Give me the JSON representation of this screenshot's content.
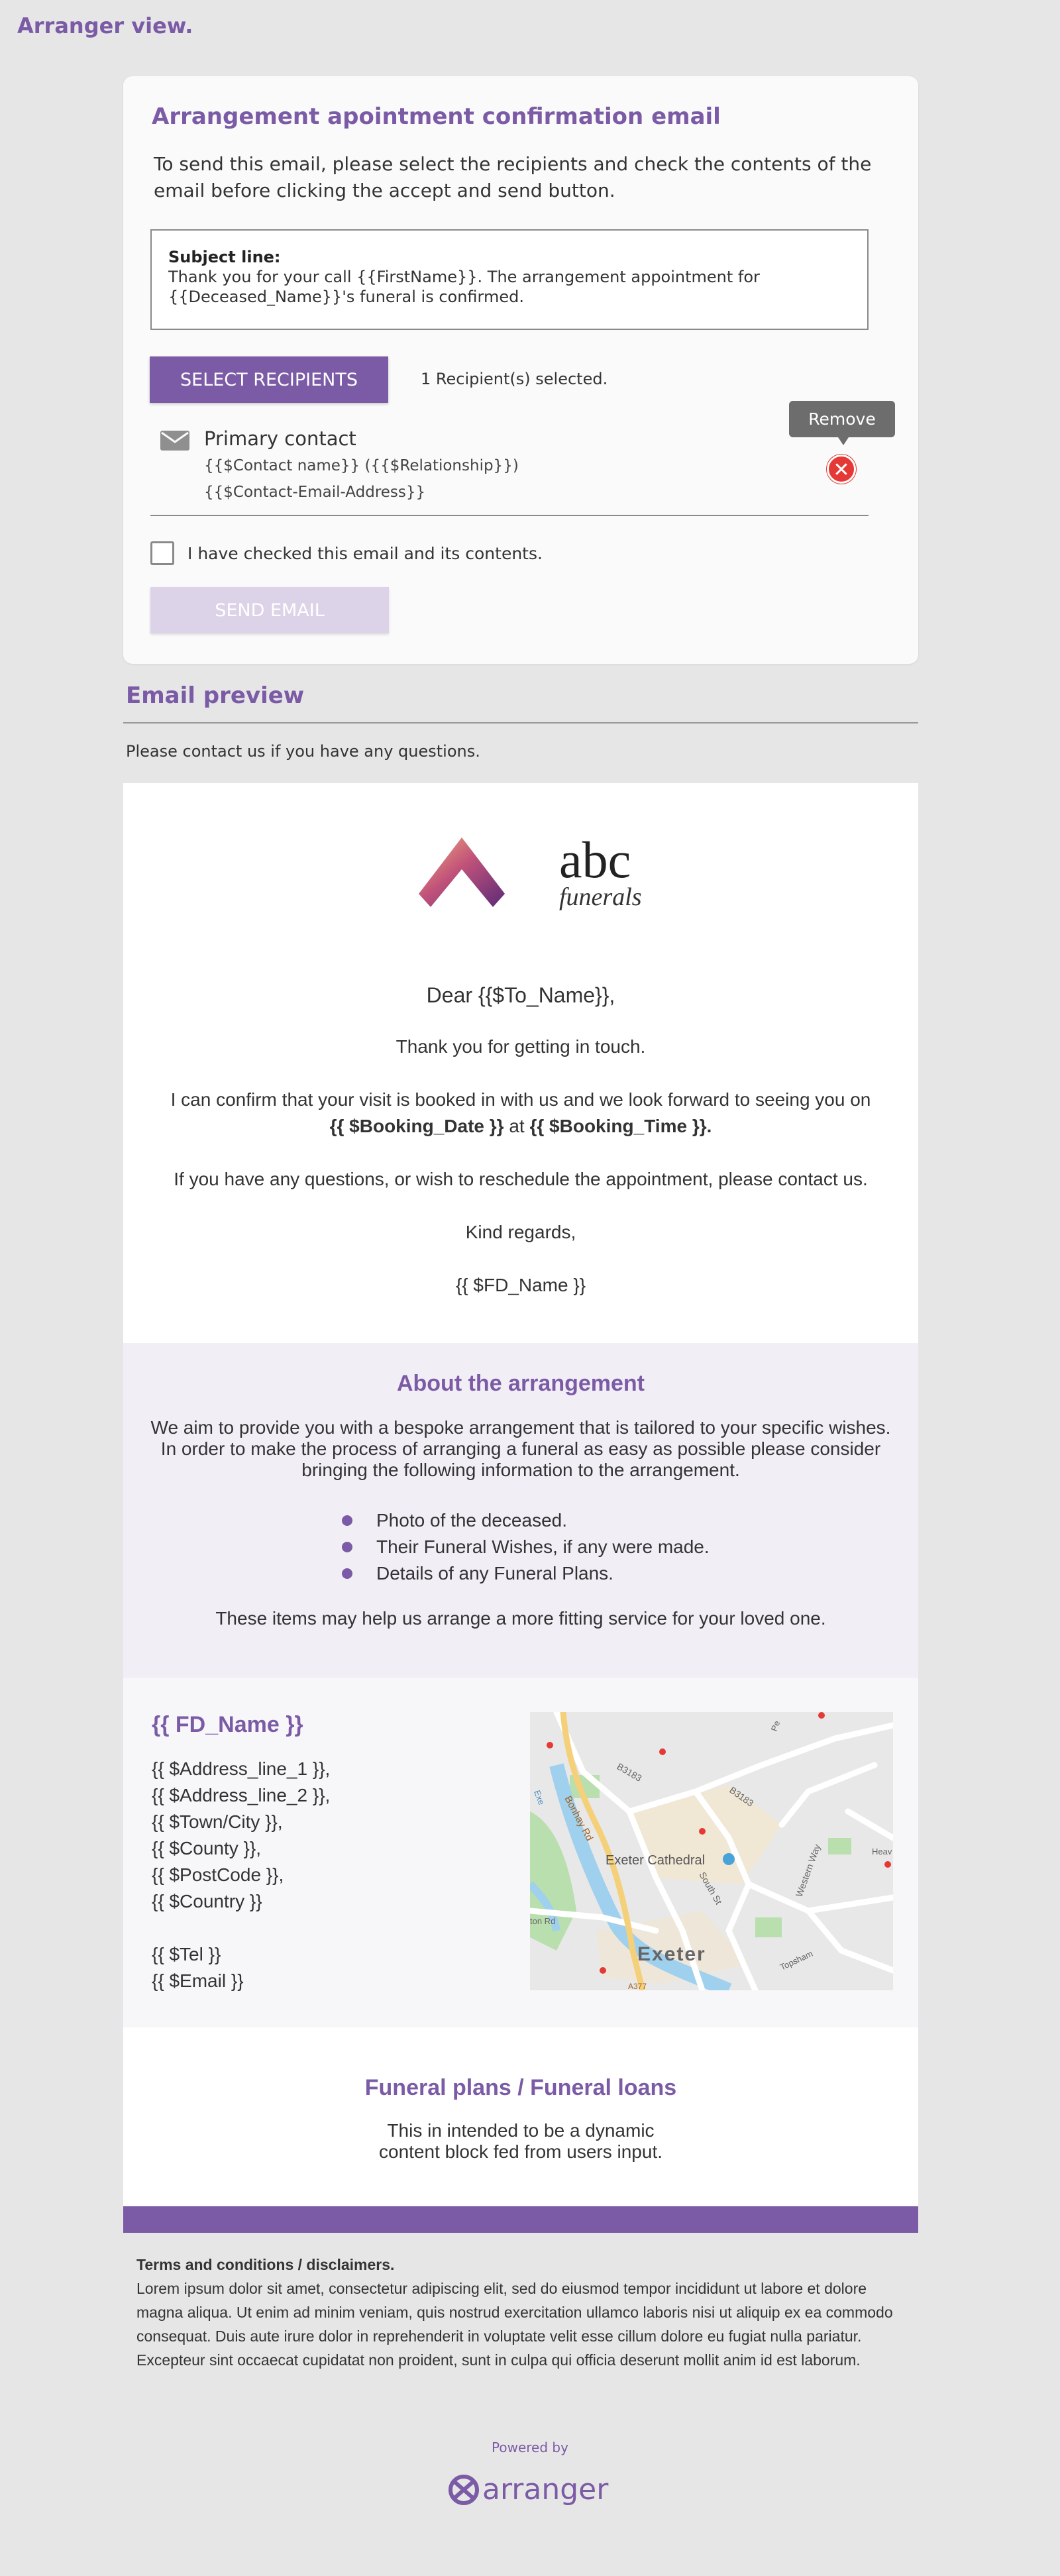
{
  "page": {
    "view_title": "Arranger view."
  },
  "card": {
    "title": "Arrangement apointment confirmation email",
    "intro": "To send this email, please select the recipients and check the contents of the email before clicking the accept and send button.",
    "subject_label": "Subject line:",
    "subject_text": "Thank you for your call {{FirstName}}. The arrangement appointment for {{Deceased_Name}}'s funeral is confirmed.",
    "select_button": "SELECT RECIPIENTS",
    "recipient_count": "1 Recipient(s) selected.",
    "remove_tooltip": "Remove",
    "remove_symbol": "✕",
    "recipient": {
      "name": "Primary contact",
      "line1": "{{$Contact name}} ({{$Relationship}})",
      "line2": "{{$Contact-Email-Address}}"
    },
    "checkbox_label": "I have checked this email and its contents.",
    "checkbox_checked": false,
    "send_button": "SEND EMAIL"
  },
  "preview": {
    "title": "Email preview",
    "note": "Please contact us if you have any questions."
  },
  "email": {
    "logo_brand": "abc",
    "logo_sub": "funerals",
    "dear": "Dear {{$To_Name}},",
    "thanks": "Thank you for getting in touch.",
    "confirm_line": "I can confirm that your visit is booked in with us and we look forward to seeing you on",
    "booking_date": "{{ $Booking_Date }}",
    "at": " at ",
    "booking_time": "{{ $Booking_Time }}.",
    "questions": "If you have any questions, or wish to reschedule the appointment, please contact us.",
    "regards": "Kind regards,",
    "fd_name": "{{ $FD_Name }}"
  },
  "about": {
    "title": "About the arrangement",
    "text": "We aim to provide you with a bespoke arrangement that is tailored to your specific wishes. In order to make the process of arranging a funeral as easy as possible please consider bringing the following information to the arrangement.",
    "items": [
      "Photo of the deceased.",
      "Their Funeral Wishes, if any were made.",
      "Details of any Funeral Plans."
    ],
    "footer": "These items may help us arrange a more fitting service for your loved one."
  },
  "address": {
    "fd_name": "{{ FD_Name }}",
    "lines": [
      "{{ $Address_line_1 }},",
      "{{ $Address_line_2 }},",
      "{{ $Town/City }},",
      "{{ $County }},",
      "{{ $PostCode }},",
      "{{ $Country }}"
    ],
    "tel": "{{ $Tel }}",
    "email": "{{ $Email }}",
    "map": {
      "city": "Exeter",
      "landmark": "Exeter Cathedral",
      "roads": [
        "B3183",
        "B3183",
        "Bonhay Rd",
        "Western Way",
        "South St",
        "Heav",
        "Pe",
        "Topsham",
        "ton Rd",
        "A377",
        "Exe"
      ]
    }
  },
  "plans": {
    "title": "Funeral plans / Funeral loans",
    "text": "This in intended to be a dynamic content block fed from users input."
  },
  "terms": {
    "title": "Terms and conditions / disclaimers.",
    "text": "Lorem ipsum dolor sit amet, consectetur adipiscing elit, sed do eiusmod tempor incididunt ut labore et dolore magna aliqua. Ut enim ad minim veniam, quis nostrud exercitation ullamco laboris nisi ut aliquip ex ea commodo consequat. Duis aute irure dolor in reprehenderit in voluptate velit esse cillum dolore eu fugiat nulla pariatur. Excepteur sint occaecat cupidatat non proident, sunt in culpa qui officia deserunt mollit anim id est laborum."
  },
  "footer": {
    "powered_by": "Powered by",
    "brand": "arranger"
  },
  "colors": {
    "accent": "#7b5ba6",
    "send_disabled": "#ddd3e8",
    "remove_red": "#e53935",
    "page_bg": "#e6e6e6"
  }
}
